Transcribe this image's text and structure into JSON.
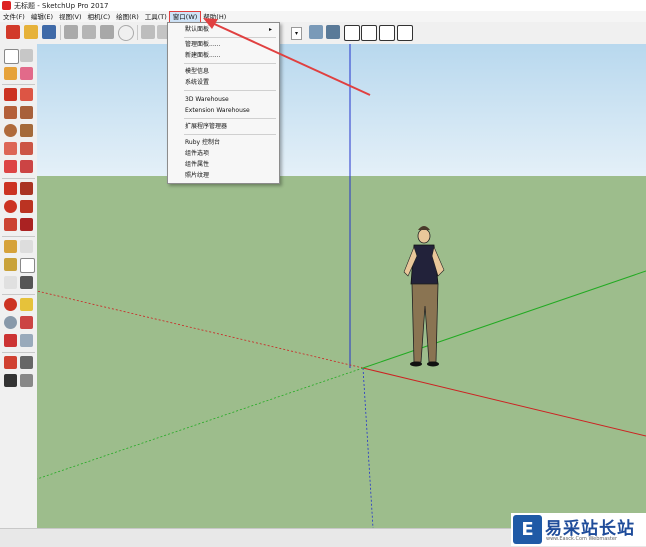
{
  "window": {
    "title": "无标题 - SketchUp Pro 2017",
    "logo_icon": "sketchup-logo-icon"
  },
  "menubar": {
    "items": [
      {
        "label": "文件(F)"
      },
      {
        "label": "编辑(E)"
      },
      {
        "label": "视图(V)"
      },
      {
        "label": "相机(C)"
      },
      {
        "label": "绘图(R)"
      },
      {
        "label": "工具(T)"
      },
      {
        "label": "窗口(W)",
        "active": true
      },
      {
        "label": "帮助(H)"
      }
    ]
  },
  "window_menu": {
    "items": [
      {
        "label": "默认面板",
        "submenu": true,
        "arrow": "▸"
      },
      {
        "label": "管理面板......"
      },
      {
        "label": "新建面板......"
      },
      {
        "label": "模型信息"
      },
      {
        "label": "系统设置"
      },
      {
        "label": "3D Warehouse"
      },
      {
        "label": "Extension Warehouse"
      },
      {
        "label": "扩展程序管理器"
      },
      {
        "label": "Ruby 控制台"
      },
      {
        "label": "组件选项"
      },
      {
        "label": "组件属性"
      },
      {
        "label": "照片纹理"
      }
    ]
  },
  "toolbar": {
    "dropdown_glyph": "▾"
  },
  "colors": {
    "sky_top": "#b8d8ee",
    "ground": "#9dbd8c",
    "axis_blue": "#2233cc",
    "axis_red": "#cc2222",
    "axis_green": "#22aa22",
    "annotation_red": "#e04040",
    "menu_highlight": "#cfe3f7"
  },
  "watermark": {
    "logo_glyph": "E",
    "text": "易采站长站",
    "sub": "www.Easck.Com  Webmaster"
  }
}
